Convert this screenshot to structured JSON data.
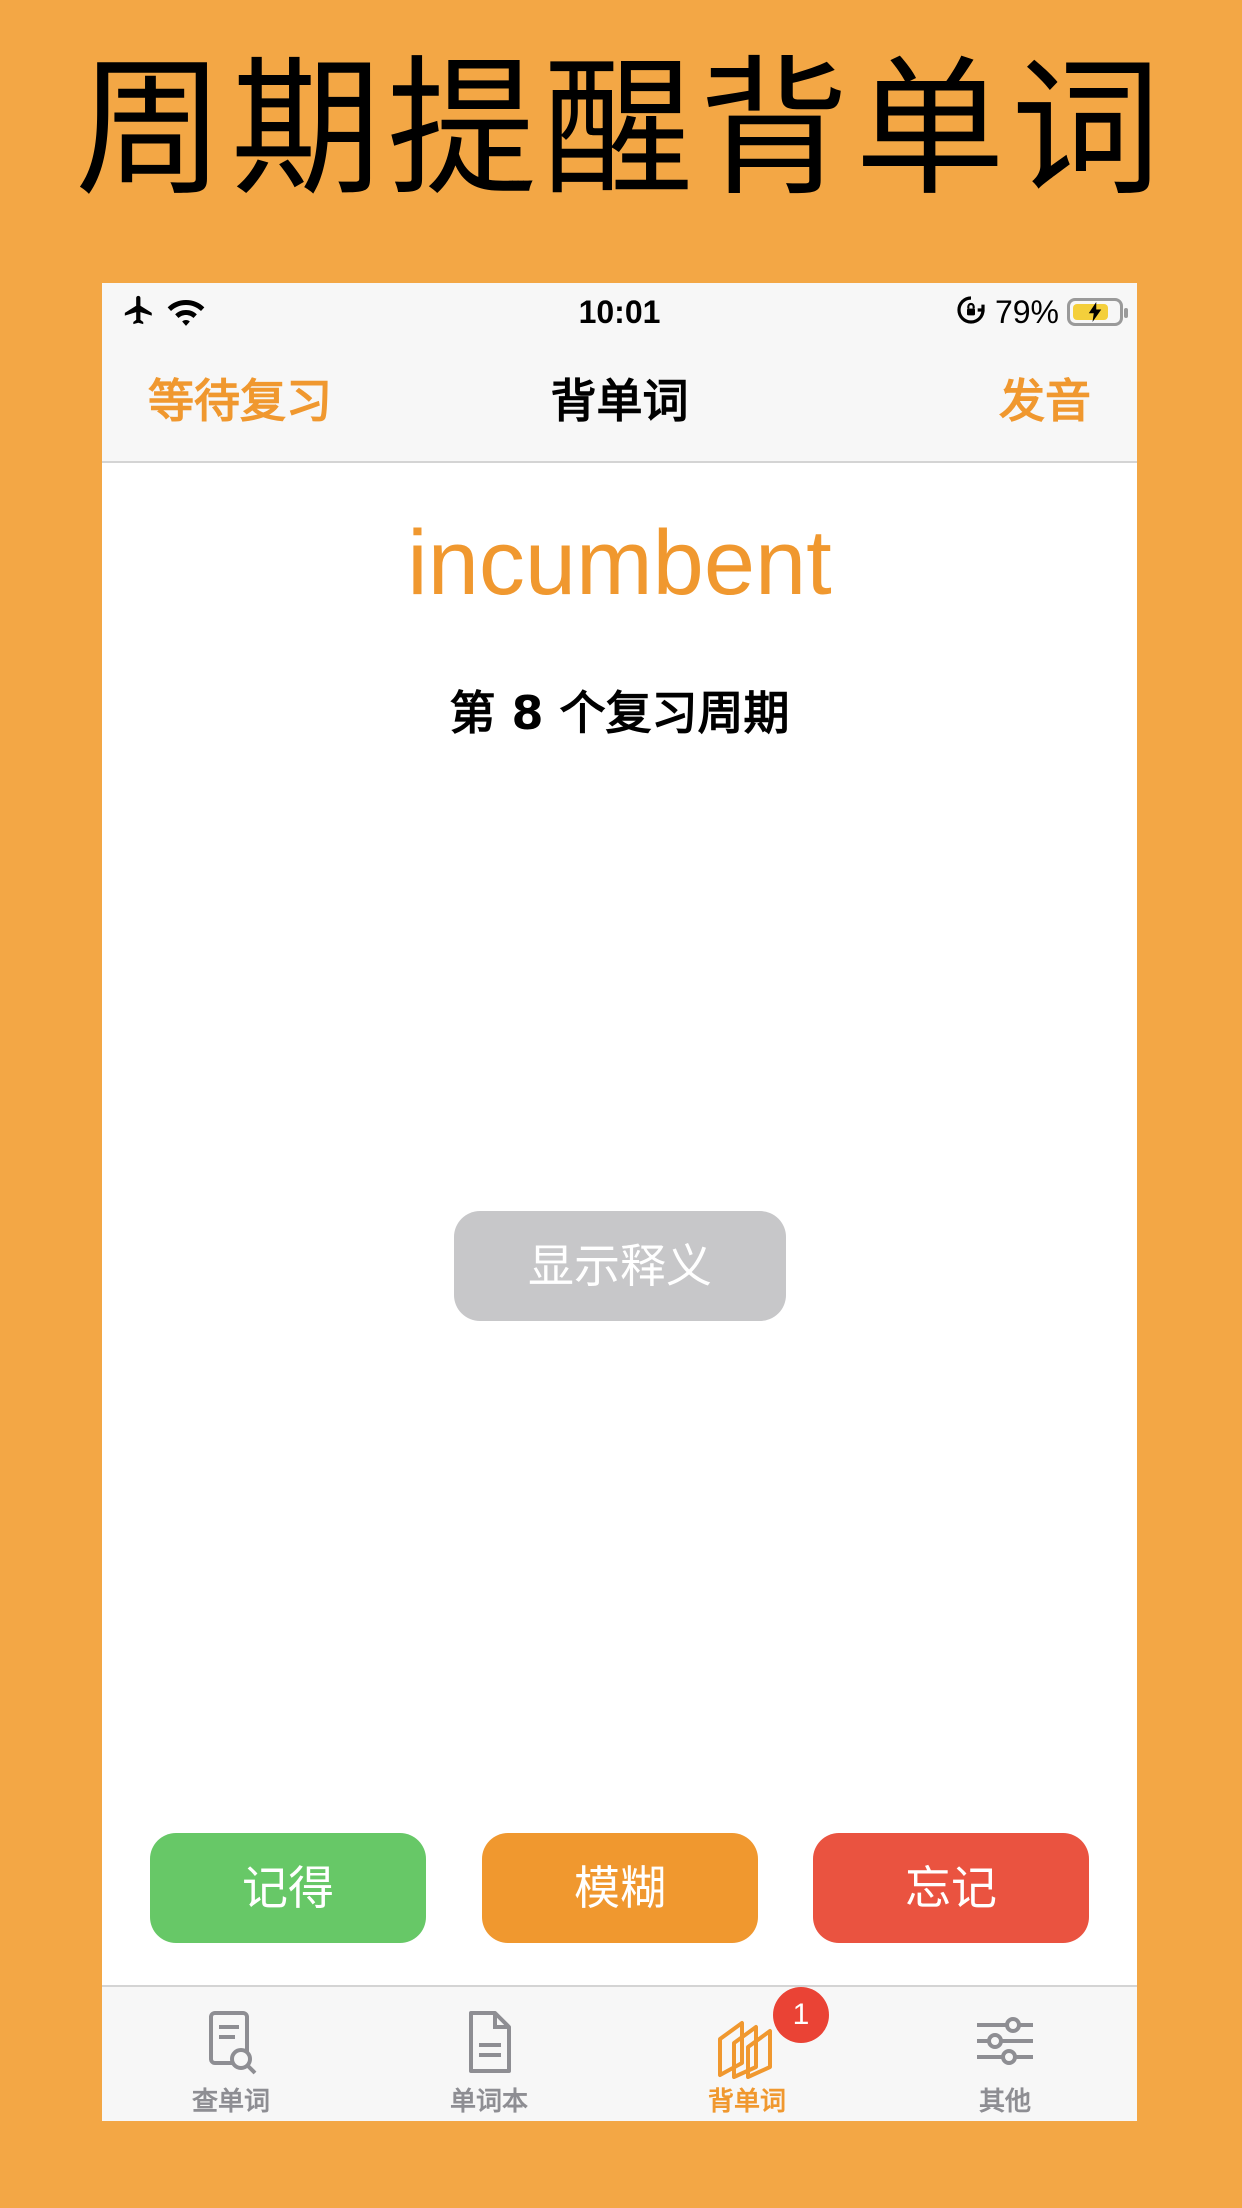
{
  "promo": {
    "title": "周期提醒背单词"
  },
  "status_bar": {
    "time": "10:01",
    "battery_percent": "79%",
    "battery_level": 0.79,
    "icons": [
      "airplane-icon",
      "wifi-icon",
      "orientation-lock-icon",
      "battery-charging-icon"
    ]
  },
  "nav": {
    "left": "等待复习",
    "title": "背单词",
    "right": "发音"
  },
  "card": {
    "word": "incumbent",
    "cycle_label": "第 8 个复习周期",
    "show_meaning": "显示释义"
  },
  "actions": {
    "remember": "记得",
    "fuzzy": "模糊",
    "forget": "忘记"
  },
  "tabbar": {
    "tabs": [
      {
        "label": "查单词",
        "icon": "search-document-icon"
      },
      {
        "label": "单词本",
        "icon": "document-icon"
      },
      {
        "label": "背单词",
        "icon": "cards-icon",
        "badge": "1",
        "active": true
      },
      {
        "label": "其他",
        "icon": "sliders-icon"
      }
    ]
  },
  "colors": {
    "accent": "#F0982F",
    "background": "#F3A745",
    "remember": "#67C867",
    "forget": "#EA5340",
    "disabled": "#C7C7C9"
  }
}
